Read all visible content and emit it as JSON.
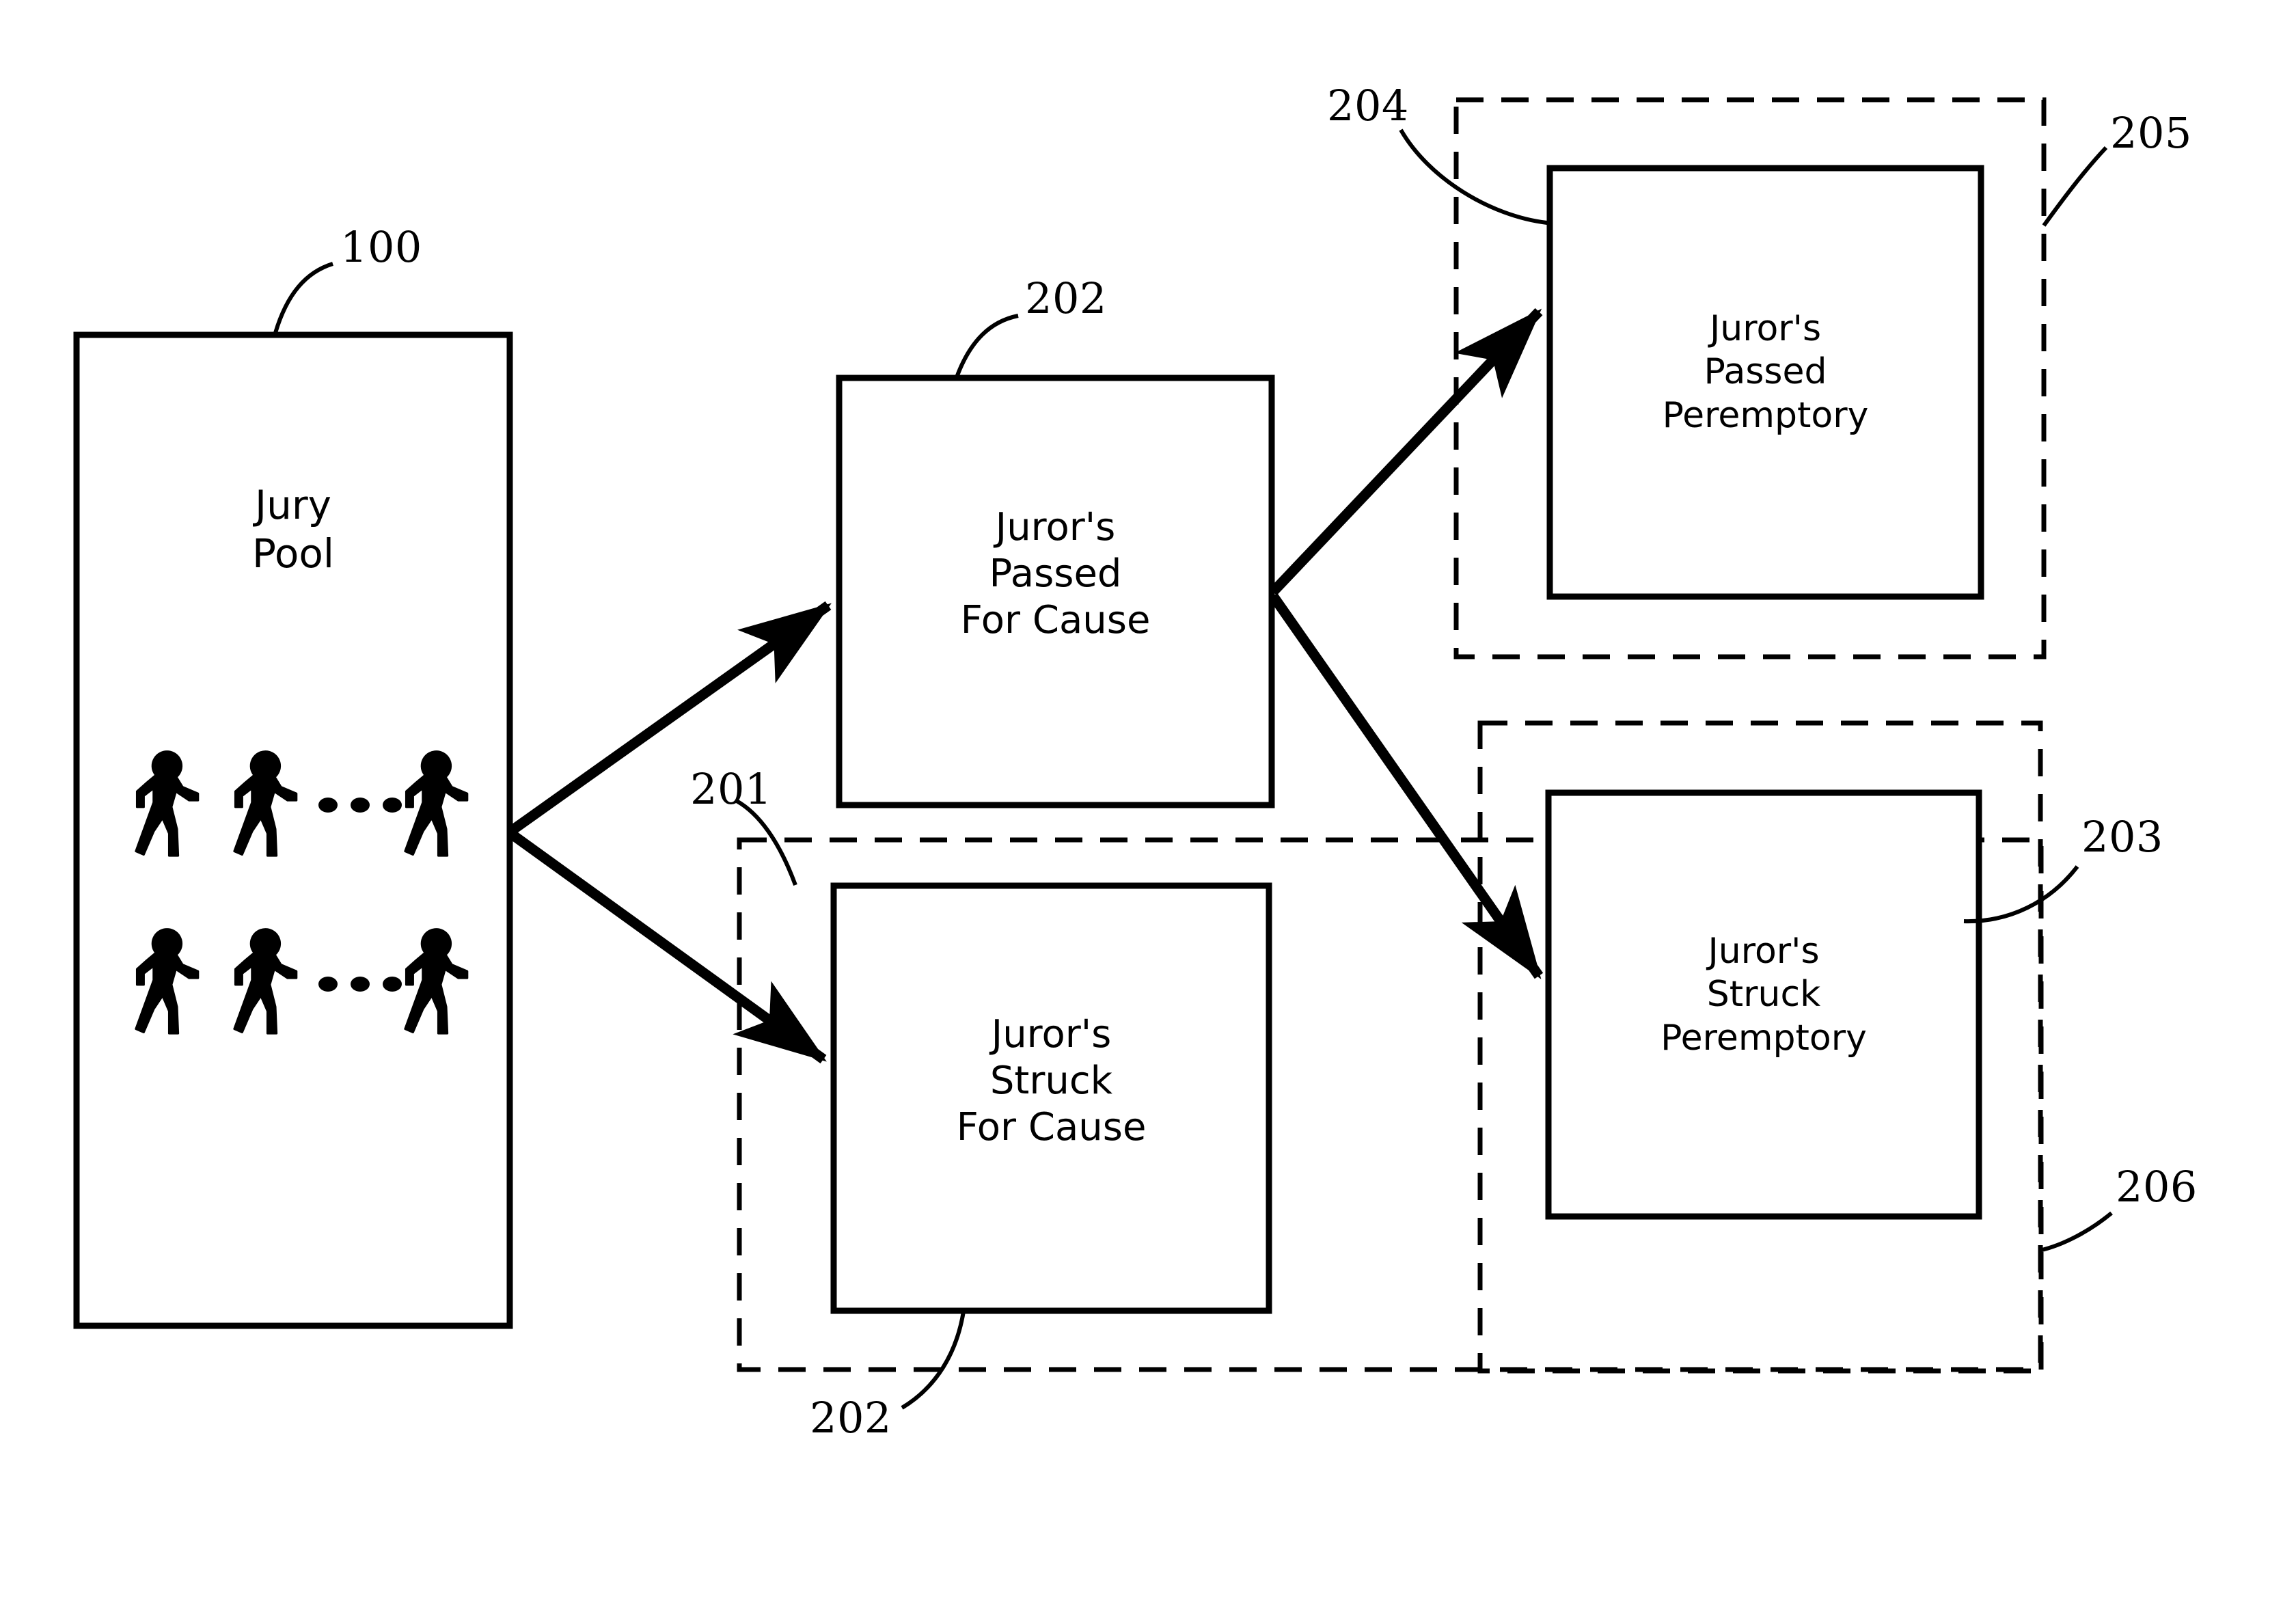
{
  "figure": {
    "kind": "patent-flow-diagram",
    "stroke_color": "#000000",
    "background_color": "#ffffff"
  },
  "nodes": {
    "jury_pool": {
      "ref": "100",
      "lines": [
        "Jury",
        "Pool"
      ],
      "style": "solid",
      "people_rows": 2,
      "people_per_row": 3,
      "ellipsis": "•  •  •"
    },
    "passed_for_cause": {
      "ref": "202",
      "lines": [
        "Juror's",
        "Passed",
        "For Cause"
      ],
      "style": "solid"
    },
    "struck_for_cause": {
      "ref": "202",
      "lines": [
        "Juror's",
        "Struck",
        "For Cause"
      ],
      "style": "solid"
    },
    "passed_peremptory": {
      "ref": "204",
      "lines": [
        "Juror's",
        "Passed",
        "Peremptory"
      ],
      "style": "solid"
    },
    "struck_peremptory": {
      "ref": "203",
      "lines": [
        "Juror's",
        "Struck",
        "Peremptory"
      ],
      "style": "solid"
    }
  },
  "groups": {
    "struck_for_cause_group": {
      "ref": "201",
      "style": "dashed"
    },
    "passed_peremptory_group": {
      "ref": "205",
      "style": "dashed"
    },
    "excluded_group": {
      "ref": "206",
      "style": "dashed"
    }
  },
  "reference_numerals": {
    "n100": "100",
    "n201": "201",
    "n202_top": "202",
    "n202_bottom": "202",
    "n203": "203",
    "n204": "204",
    "n205": "205",
    "n206": "206"
  },
  "edges": [
    {
      "from": "jury_pool",
      "to": "passed_for_cause",
      "arrow": true
    },
    {
      "from": "jury_pool",
      "to": "struck_for_cause",
      "arrow": true
    },
    {
      "from": "passed_for_cause",
      "to": "passed_peremptory",
      "arrow": true
    },
    {
      "from": "passed_for_cause",
      "to": "struck_peremptory",
      "arrow": true
    }
  ]
}
